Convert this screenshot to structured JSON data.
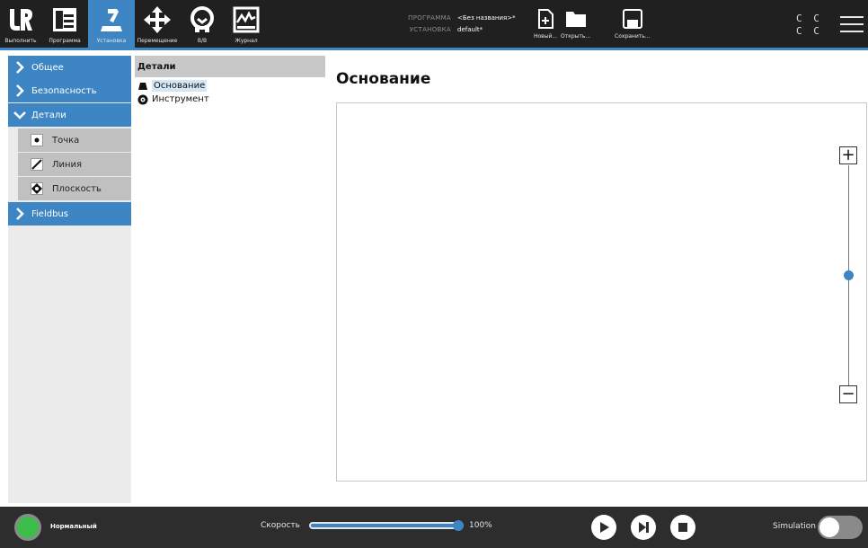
{
  "header": {
    "nav": [
      {
        "label": "Выполнить",
        "icon": "ur-logo-icon"
      },
      {
        "label": "Программа",
        "icon": "program-icon"
      },
      {
        "label": "Установка",
        "icon": "installation-icon",
        "active": true
      },
      {
        "label": "Перемещение",
        "icon": "move-icon"
      },
      {
        "label": "В/В",
        "icon": "io-icon"
      },
      {
        "label": "Журнал",
        "icon": "log-icon"
      }
    ],
    "program_key": "ПРОГРАММА",
    "program_value": "<Без названия>*",
    "install_key": "УСТАНОВКА",
    "install_value": "default*",
    "new_label": "Новый...",
    "open_label": "Открыть...",
    "save_label": "Сохранить...",
    "cc_row1": "C C",
    "cc_row2": "C C"
  },
  "sidebar": {
    "general": "Общее",
    "safety": "Безопасность",
    "features": "Детали",
    "point": "Точка",
    "line": "Линия",
    "plane": "Плоскость",
    "fieldbus": "Fieldbus"
  },
  "tree": {
    "header": "Детали",
    "base": "Основание",
    "tool": "Инструмент"
  },
  "main": {
    "title": "Основание",
    "zoom_in": "+",
    "zoom_out": "−",
    "zoom_level": 0.5
  },
  "footer": {
    "status": "Нормальный",
    "speed_label": "Скорость",
    "speed_value": "100%",
    "speed_fraction": 1.0,
    "sim_label": "Simulation",
    "sim_on": false
  },
  "colors": {
    "accent": "#3d86c3",
    "header_bg": "#202020",
    "footer_bg": "#2d2d2d",
    "status_ok": "#3cbd49"
  }
}
